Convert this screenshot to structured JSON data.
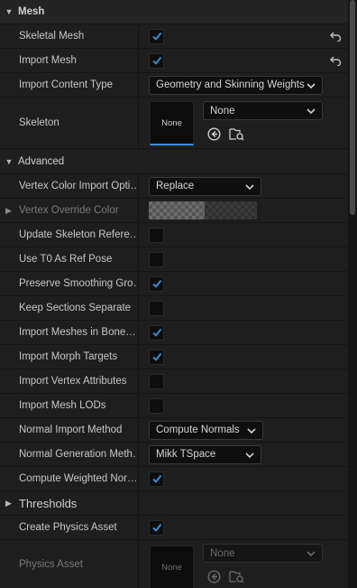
{
  "sections": {
    "mesh": "Mesh",
    "advanced": "Advanced",
    "thresholds": "Thresholds"
  },
  "rows": {
    "skeletal_mesh": {
      "label": "Skeletal Mesh",
      "checked": true
    },
    "import_mesh": {
      "label": "Import Mesh",
      "checked": true
    },
    "import_content_type": {
      "label": "Import Content Type",
      "value": "Geometry and Skinning Weights"
    },
    "skeleton": {
      "label": "Skeleton",
      "thumb": "None",
      "value": "None"
    },
    "vertex_color_import": {
      "label": "Vertex Color Import Opti…",
      "value": "Replace"
    },
    "vertex_override_color": {
      "label": "Vertex Override Color"
    },
    "update_skeleton": {
      "label": "Update Skeleton Refere…",
      "checked": false
    },
    "use_t0": {
      "label": "Use T0 As Ref Pose",
      "checked": false
    },
    "preserve_smoothing": {
      "label": "Preserve Smoothing Gro…",
      "checked": true
    },
    "keep_sections": {
      "label": "Keep Sections Separate",
      "checked": false
    },
    "import_meshes_bone": {
      "label": "Import Meshes in Bone…",
      "checked": true
    },
    "import_morph": {
      "label": "Import Morph Targets",
      "checked": true
    },
    "import_vertex_attr": {
      "label": "Import Vertex Attributes",
      "checked": false
    },
    "import_mesh_lods": {
      "label": "Import Mesh LODs",
      "checked": false
    },
    "normal_import": {
      "label": "Normal Import Method",
      "value": "Compute Normals"
    },
    "normal_generation": {
      "label": "Normal Generation Meth…",
      "value": "Mikk TSpace"
    },
    "compute_weighted": {
      "label": "Compute Weighted Nor…",
      "checked": true
    },
    "create_physics": {
      "label": "Create Physics Asset",
      "checked": true
    },
    "physics_asset": {
      "label": "Physics Asset",
      "thumb": "None",
      "value": "None"
    }
  },
  "icons": {
    "reset": "reset-arrow-icon",
    "check": "checkmark-icon",
    "chevron": "chevron-down-icon",
    "use_selected": "use-selected-arrow-icon",
    "browse": "browse-folder-icon"
  },
  "colors": {
    "accent": "#3b8fd6"
  }
}
